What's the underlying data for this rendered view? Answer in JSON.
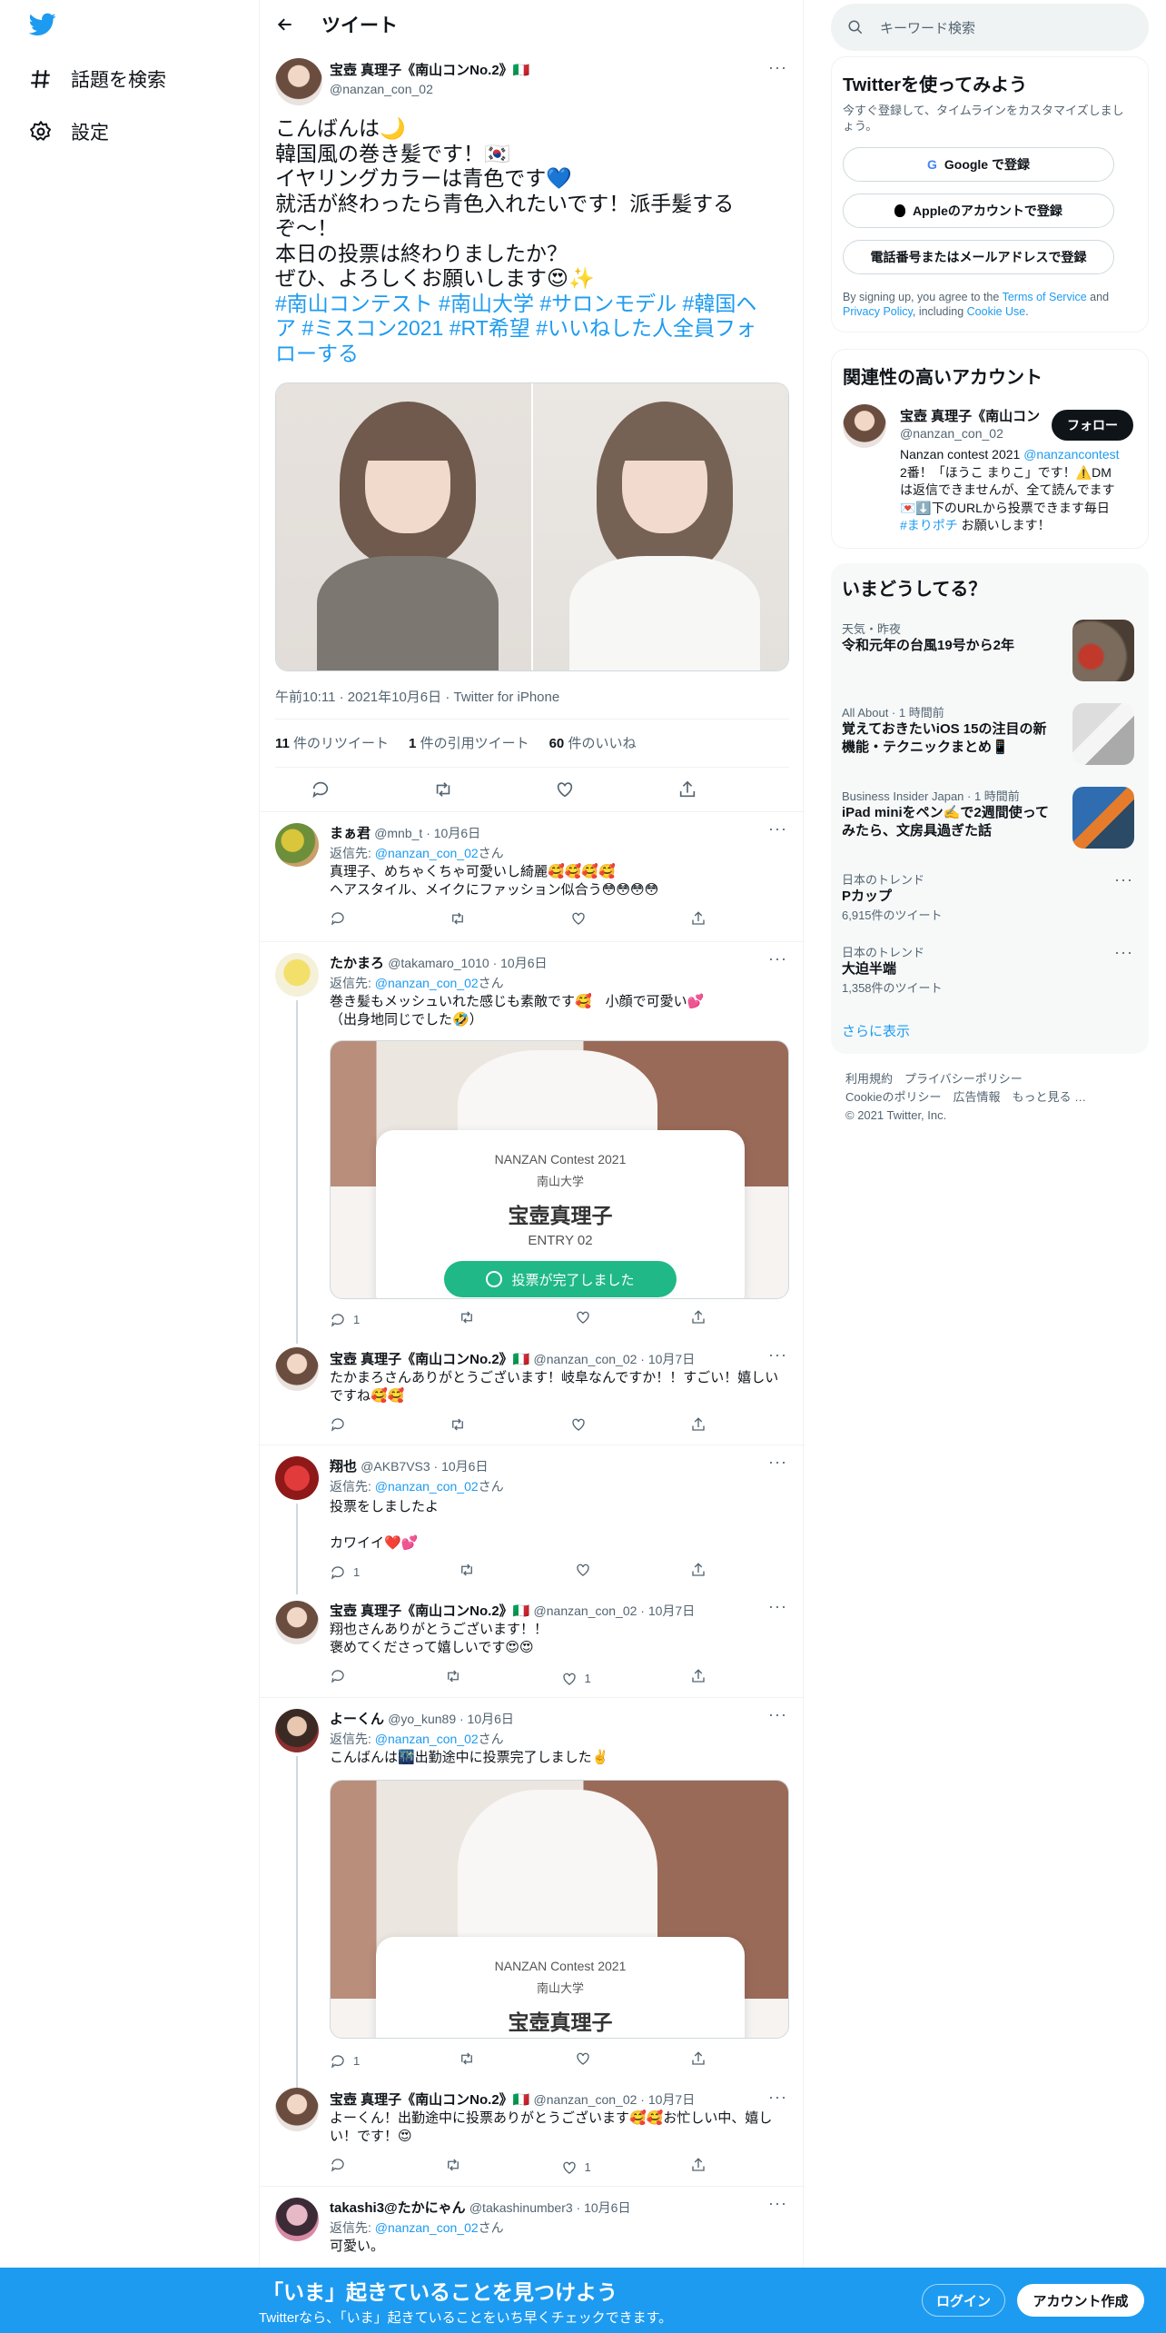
{
  "nav": {
    "explore": "話題を検索",
    "settings": "設定"
  },
  "header": {
    "title": "ツイート"
  },
  "main_tweet": {
    "name": "宝壺 真理子《南山コンNo.2》🇮🇹",
    "handle": "@nanzan_con_02",
    "lines": [
      "こんばんは🌙",
      "韓国風の巻き髪です！🇰🇷",
      "イヤリングカラーは青色です💙",
      "就活が終わったら青色入れたいです！派手髪する",
      "ぞ〜！",
      "本日の投票は終わりましたか？",
      "ぜひ、よろしくお願いします😍✨"
    ],
    "hashtags": [
      "#南山コンテスト #南山大学 #サロンモデル #韓国ヘ",
      "ア  #ミスコン2021  #RT希望 #いいねした人全員フォ",
      "ローする"
    ],
    "meta": "午前10:11 · 2021年10月6日 · Twitter for iPhone",
    "retweets": "11",
    "retweets_label": "件のリツイート",
    "quotes": "1",
    "quotes_label": "件の引用ツイート",
    "likes": "60",
    "likes_label": "件のいいね"
  },
  "replies": [
    {
      "name": "まぁ君",
      "meta": "@mnb_t · 10月6日",
      "to_prefix": "返信先: ",
      "to": "@nanzan_con_02",
      "to_suffix": "さん",
      "text": [
        "真理子、めちゃくちゃ可愛いし綺麗🥰🥰🥰🥰",
        "ヘアスタイル、メイクにファッション似合う😳😳😳😳"
      ],
      "reply_count": "",
      "like_count": ""
    },
    {
      "name": "たかまろ",
      "meta": "@takamaro_1010 · 10月6日",
      "to_prefix": "返信先: ",
      "to": "@nanzan_con_02",
      "to_suffix": "さん",
      "text": [
        "巻き髪もメッシュいれた感じも素敵です🥰　小顔で可愛い💕",
        "（出身地同じでした🤣）"
      ],
      "reply_count": "1",
      "like_count": ""
    },
    {
      "name": "宝壺 真理子《南山コンNo.2》🇮🇹",
      "meta": "@nanzan_con_02 · 10月7日",
      "text": [
        "たかまろさんありがとうございます！岐阜なんですか！！すごい！嬉しい",
        "ですね🥰🥰"
      ],
      "reply_count": "",
      "like_count": ""
    },
    {
      "name": "翔也",
      "meta": "@AKB7VS3 · 10月6日",
      "to_prefix": "返信先: ",
      "to": "@nanzan_con_02",
      "to_suffix": "さん",
      "text": [
        "投票をしましたよ",
        "",
        "カワイイ❤️💕"
      ],
      "reply_count": "1",
      "like_count": ""
    },
    {
      "name": "宝壺 真理子《南山コンNo.2》🇮🇹",
      "meta": "@nanzan_con_02 · 10月7日",
      "text": [
        "翔也さんありがとうございます！！",
        "褒めてくださって嬉しいです😍😍"
      ],
      "reply_count": "",
      "like_count": "1"
    },
    {
      "name": "よーくん",
      "meta": "@yo_kun89 · 10月6日",
      "to_prefix": "返信先: ",
      "to": "@nanzan_con_02",
      "to_suffix": "さん",
      "text": [
        "こんばんは🌃出勤途中に投票完了しました✌️"
      ],
      "reply_count": "1",
      "like_count": ""
    },
    {
      "name": "宝壺 真理子《南山コンNo.2》🇮🇹",
      "meta": "@nanzan_con_02 · 10月7日",
      "text": [
        "よーくん！出勤途中に投票ありがとうございます🥰🥰お忙しい中、嬉し",
        "い！です！😍"
      ],
      "reply_count": "",
      "like_count": "1"
    },
    {
      "name": "takashi3@たかにゃん",
      "meta": "@takashinumber3 · 10月6日",
      "to_prefix": "返信先: ",
      "to": "@nanzan_con_02",
      "to_suffix": "さん",
      "text": [
        "可愛い。"
      ],
      "reply_count": "",
      "like_count": ""
    }
  ],
  "card": {
    "contest": "NANZAN Contest 2021",
    "school": "南山大学",
    "name": "宝壺真理子",
    "entry": "ENTRY 02",
    "done": "投票が完了しました"
  },
  "search": {
    "placeholder": "キーワード検索"
  },
  "signup": {
    "title": "Twitterを使ってみよう",
    "desc": "今すぐ登録して、タイムラインをカスタマイズしましょう。",
    "google": "Google で登録",
    "apple": "Appleのアカウントで登録",
    "phone": "電話番号またはメールアドレスで登録",
    "terms_pre": "By signing up, you agree to the ",
    "terms": "Terms of Service",
    "and": " and",
    "privacy": "Privacy Policy",
    "cookie_pre": ", including ",
    "cookie": "Cookie Use",
    "end": "."
  },
  "related": {
    "title": "関連性の高いアカウント",
    "name": "宝壺 真理子《南山コン",
    "handle": "@nanzan_con_02",
    "follow": "フォロー",
    "bio": [
      "Nanzan contest 2021 ",
      "@nanzancontest"
    ],
    "bio2": "2番！「ほうこ まりこ」です！⚠️DM",
    "bio3": "は返信できませんが、全て読んでます",
    "bio4": "💌⬇️下のURLから投票できます毎日",
    "bio5_tag": "#まりポチ",
    "bio5": " お願いします！"
  },
  "trends": {
    "title": "いまどうしてる？",
    "items": [
      {
        "top": "天気・昨夜",
        "text": "令和元年の台風19号から2年"
      },
      {
        "top": "All About · 1 時間前",
        "text": "覚えておきたいiOS 15の注目の新機能・テクニックまとめ📱"
      },
      {
        "top": "Business Insider Japan · 1 時間前",
        "text": "iPad miniをペン✍️で2週間使ってみたら、文房具過ぎた話"
      },
      {
        "top": "日本のトレンド",
        "text": "Pカップ",
        "count": "6,915件のツイート"
      },
      {
        "top": "日本のトレンド",
        "text": "大迫半端",
        "count": "1,358件のツイート"
      }
    ],
    "more": "さらに表示"
  },
  "footer": {
    "l1": "利用規約　プライバシーポリシー",
    "l2": "Cookieのポリシー　広告情報　もっと見る …",
    "l3": "© 2021 Twitter, Inc."
  },
  "banner": {
    "title": "「いま」起きていることを見つけよう",
    "sub": "Twitterなら、「いま」起きていることをいち早くチェックできます。",
    "login": "ログイン",
    "signup": "アカウント作成"
  },
  "colors": {
    "accent": "#1d9bf0",
    "text": "#0f1419",
    "muted": "#536471"
  }
}
